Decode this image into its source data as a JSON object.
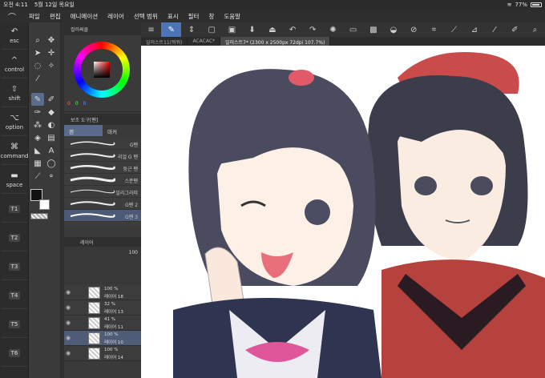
{
  "status": {
    "time": "오전 4:11",
    "date": "5월 12일 목요일",
    "battery": "77%",
    "battery_level": 0.77
  },
  "menu": {
    "items": [
      "파일",
      "편집",
      "애니메이션",
      "레이어",
      "선택 범위",
      "표시",
      "필터",
      "창",
      "도움말"
    ]
  },
  "shortcuts": {
    "esc": "esc",
    "control": "control",
    "shift": "shift",
    "option": "option",
    "command": "command",
    "space": "space",
    "t1": "T1",
    "t2": "T2",
    "t3": "T3",
    "t4": "T4",
    "t5": "T5",
    "t6": "T6"
  },
  "panels": {
    "color_tab": "컬러써클",
    "color_values": [
      "0",
      "0",
      "0"
    ],
    "subtool_title": "보조 도구[펜]",
    "subtool_tabs": [
      "펜",
      "마커"
    ],
    "brushes": [
      "G펜",
      "리얼 G 펜",
      "둥근 펜",
      "스푼펜",
      "밀리그라피",
      "G펜 2",
      "G펜 3"
    ],
    "layer_title": "레이어",
    "layer_opacity": "100",
    "layers": [
      {
        "pct": "100 %",
        "name": "레이어 18"
      },
      {
        "pct": "32 %",
        "name": "레이어 13"
      },
      {
        "pct": "41 %",
        "name": "레이어 11"
      },
      {
        "pct": "100 %",
        "name": "레이어 10"
      },
      {
        "pct": "100 %",
        "name": "레이어 14"
      }
    ]
  },
  "canvas_tabs": [
    {
      "label": "일러스트11(뭐뭐)"
    },
    {
      "label": "ACACAC*"
    },
    {
      "label": "일러스트7* (2300 x 2500px 72dpi 107.7%)"
    }
  ]
}
